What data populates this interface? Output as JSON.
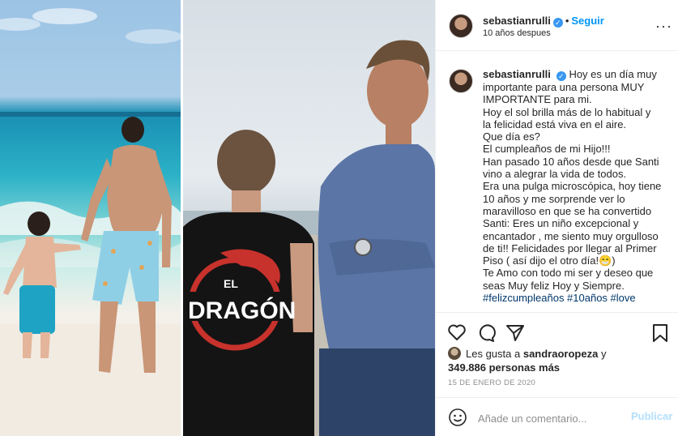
{
  "post": {
    "username": "sebastianrulli",
    "verified_mark": "✓",
    "dot": "•",
    "follow_label": "Seguir",
    "subtitle": "10 años despues",
    "more_icon": "more-options-icon"
  },
  "image": {
    "jersey_text_top": "EL",
    "jersey_text_main": "DRAGÓN"
  },
  "caption": {
    "username": "sebastianrulli",
    "lines": [
      "Hoy es un día muy",
      "importante para una persona MUY",
      "IMPORTANTE para mi.",
      "Hoy el sol brilla más de lo habitual y",
      "la felicidad está viva en el aire.",
      "Que día es?",
      "El cumpleaños de mi Hijo!!!",
      "Han pasado 10 años desde que Santi",
      "vino a alegrar la vida de todos.",
      "Era una pulga microscópica, hoy tiene",
      "10 años y me sorprende ver lo",
      "maravilloso en que se ha convertido",
      "Santi: Eres un niño excepcional y",
      "encantador , me siento muy orgulloso",
      "de ti!! Felicidades por llegar al Primer",
      "Piso ( así dijo el otro día!😁)",
      "Te Amo con todo mi ser y deseo que",
      "seas Muy feliz Hoy y Siempre."
    ],
    "hashtags": "#felizcumpleaños #10años #love"
  },
  "actions": {
    "like_icon": "heart-icon",
    "comment_icon": "comment-icon",
    "share_icon": "share-icon",
    "save_icon": "bookmark-icon"
  },
  "likes": {
    "prefix": "Les gusta a",
    "user": "sandraoropeza",
    "connector": "y",
    "count": "349.886 personas más"
  },
  "date": "15 DE ENERO DE 2020",
  "comment": {
    "emoji_icon": "emoji-icon",
    "placeholder": "Añade un comentario...",
    "post_label": "Publicar"
  },
  "colors": {
    "accent": "#0095f6",
    "verified": "#3897f0",
    "hashtag": "#00376b",
    "post_disabled": "#b2dffc"
  }
}
